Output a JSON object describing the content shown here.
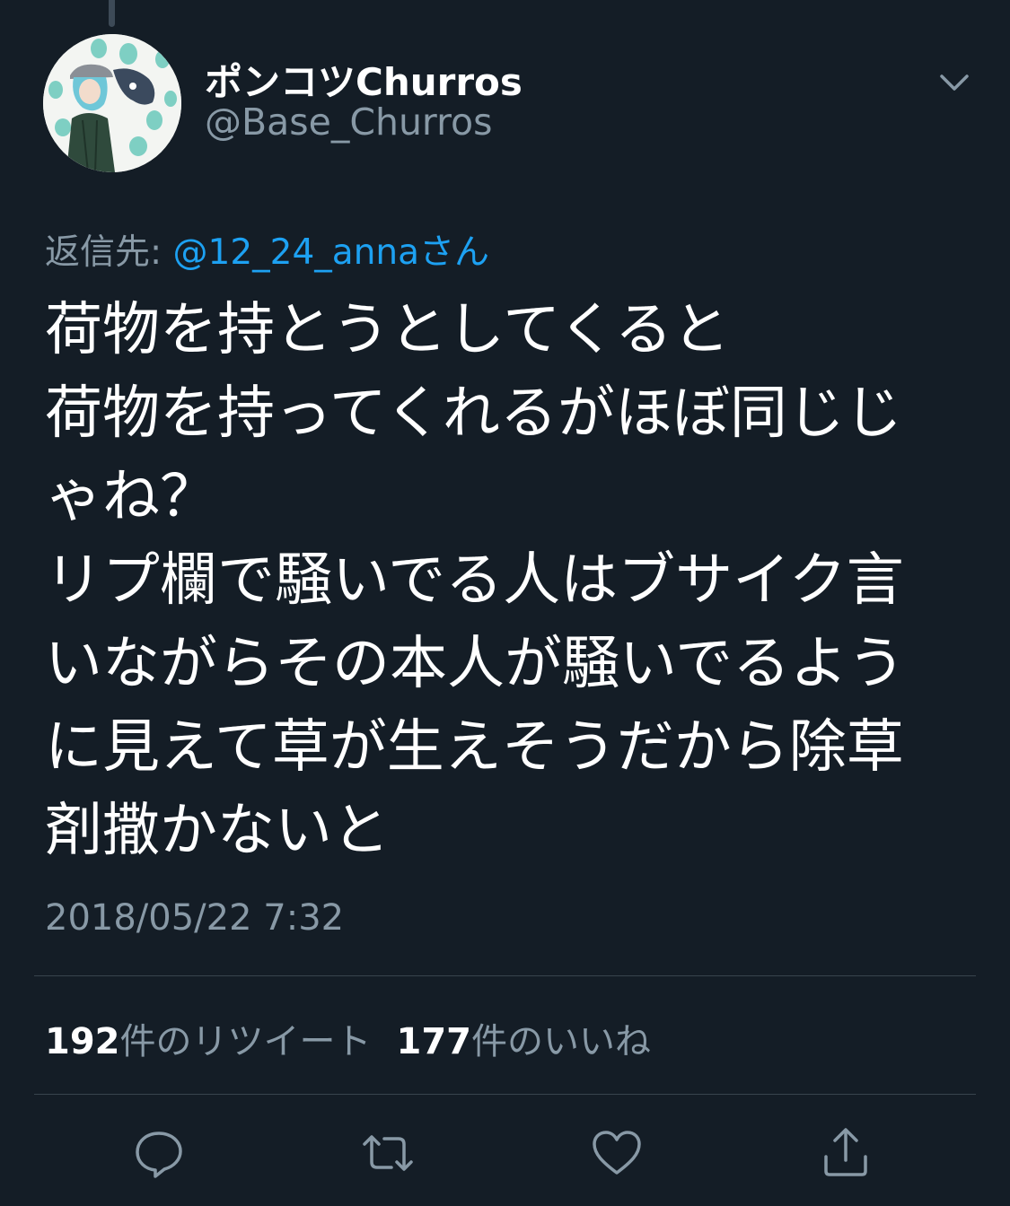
{
  "author": {
    "display_name": "ポンコツChurros",
    "handle": "@Base_Churros",
    "avatar_icon": "avatar-illustration"
  },
  "reply": {
    "prefix": "返信先: ",
    "mention": "@12_24_annaさん"
  },
  "tweet": {
    "text": "荷物を持とうとしてくると\n荷物を持ってくれるがほぼ同じじゃね？\nリプ欄で騒いでる人はブサイク言いながらその本人が騒いでるように見えて草が生えそうだから除草剤撒かないと",
    "timestamp": "2018/05/22 7:32"
  },
  "stats": {
    "retweets_count": "192",
    "retweets_label": "件のリツイート",
    "likes_count": "177",
    "likes_label": "件のいいね"
  },
  "actions": {
    "icons": [
      "reply-icon",
      "retweet-icon",
      "like-icon",
      "share-icon"
    ]
  },
  "colors": {
    "background": "#141d26",
    "text": "#ffffff",
    "secondary": "#8899a6",
    "accent": "#1da1f2",
    "divider": "#38444d"
  }
}
